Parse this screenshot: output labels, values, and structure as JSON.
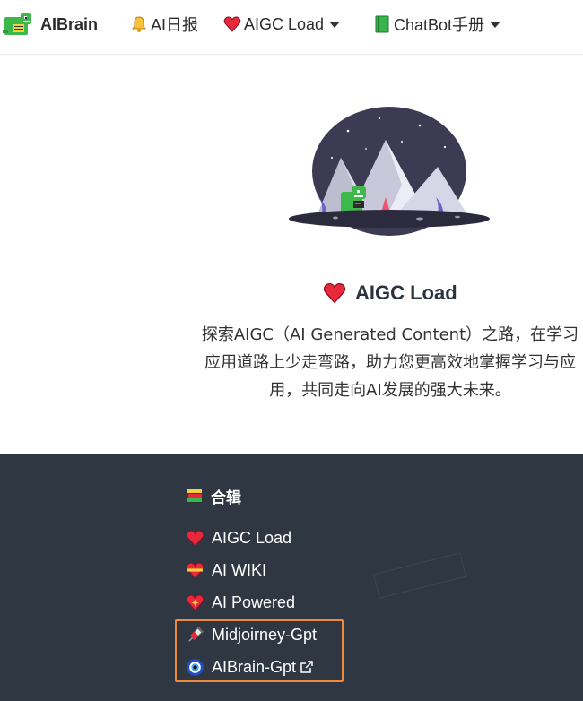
{
  "nav": {
    "brand": "AIBrain",
    "items": [
      {
        "label": "AI日报",
        "icon": "bell-icon",
        "has_dropdown": false
      },
      {
        "label": "AIGC Load",
        "icon": "heart-icon",
        "has_dropdown": true
      },
      {
        "label": "ChatBot手册",
        "icon": "green-book-icon",
        "has_dropdown": true
      }
    ]
  },
  "hero": {
    "title": "AIGC Load",
    "description": "探索AIGC（AI Generated Content）之路，在学习应用道路上少走弯路，助力您更高效地掌握学习与应用，共同走向AI发展的强大未来。"
  },
  "footer": {
    "heading": "合辑",
    "links": [
      {
        "label": "AIGC Load",
        "icon": "heart-icon"
      },
      {
        "label": "AI WIKI",
        "icon": "heart-ribbon-icon"
      },
      {
        "label": "AI Powered",
        "icon": "sparkling-heart-icon"
      },
      {
        "label": "Midjoirney-Gpt",
        "icon": "syringe-icon"
      },
      {
        "label": "AIBrain-Gpt",
        "icon": "nazar-amulet-icon",
        "external": true
      }
    ]
  },
  "colors": {
    "footer_bg": "#2f3742",
    "highlight_border": "#f08a3a",
    "brand_green": "#3db84a"
  }
}
